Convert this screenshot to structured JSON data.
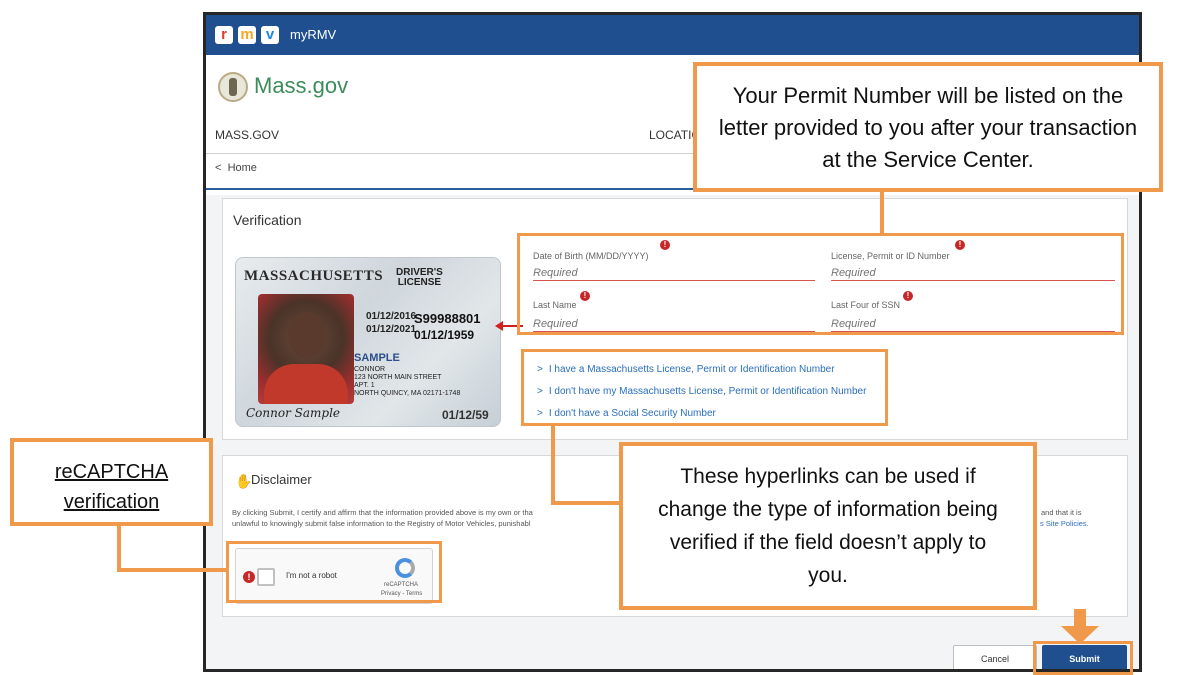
{
  "app": {
    "logo_letters": [
      "r",
      "m",
      "v"
    ],
    "logo_colors": [
      "#e53935",
      "#f9a825",
      "#1e88e5"
    ],
    "title": "myRMV"
  },
  "header": {
    "brand": "Mass.gov",
    "nav_left": "MASS.GOV",
    "nav_location": "LOCATIO",
    "breadcrumb": "Home"
  },
  "verification": {
    "title": "Verification",
    "id_card": {
      "state": "MASSACHUSETTS",
      "type_line1": "DRIVER'S",
      "type_line2": "LICENSE",
      "number": "S99988801",
      "dob": "01/12/1959",
      "issued": "01/12/2016",
      "expires": "01/12/2021",
      "sample": "SAMPLE",
      "address": "CONNOR\n123 NORTH MAIN STREET\nAPT. 1\nNORTH QUINCY, MA 02171-1748",
      "signature": "Connor Sample",
      "bottom_date": "01/12/59"
    },
    "fields": {
      "dob_label": "Date of Birth (MM/DD/YYYY)",
      "dob_placeholder": "Required",
      "license_label": "License, Permit or ID Number",
      "license_placeholder": "Required",
      "lastname_label": "Last Name",
      "lastname_placeholder": "Required",
      "ssn_label": "Last Four of SSN",
      "ssn_placeholder": "Required"
    },
    "links": [
      "I have a Massachusetts License, Permit or Identification Number",
      "I don't have my Massachusetts License, Permit or Identification Number",
      "I don't have a Social Security Number"
    ]
  },
  "disclaimer": {
    "title": "Disclaimer",
    "text_line1": "By clicking Submit, I certify and affirm that the information provided above is my own or tha",
    "text_line2": "unlawful to knowingly submit false information to the Registry of Motor Vehicles, punishabl",
    "text_tail1": "and that it is",
    "text_tail2": "s Site Policies."
  },
  "captcha": {
    "label": "I'm not a robot",
    "brand": "reCAPTCHA",
    "links": "Privacy - Terms"
  },
  "actions": {
    "cancel": "Cancel",
    "submit": "Submit"
  },
  "annotations": {
    "permit_note": "Your Permit Number will be listed on the letter provided to you after your transaction at the Service Center.",
    "recaptcha_note": "reCAPTCHA verification",
    "hyperlinks_note": "These hyperlinks can be used if change the type of information being verified if the field doesn’t apply to you.",
    "accent_color": "#f0994a"
  }
}
